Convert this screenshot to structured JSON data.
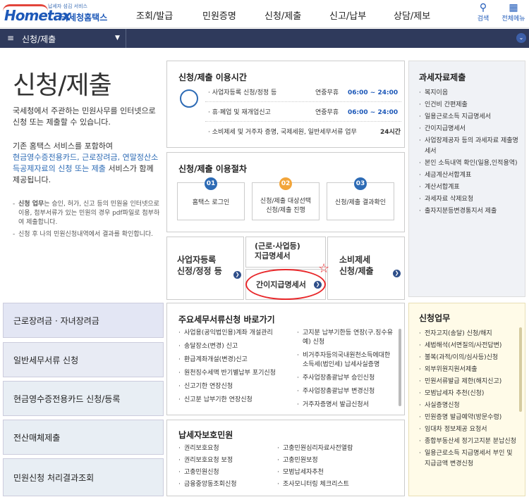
{
  "header": {
    "logo_small": "납세자 섬김 서비스",
    "logo_main": "Hometax",
    "logo_kr": "국세청홈택스",
    "nav": [
      "조회/발급",
      "민원증명",
      "신청/제출",
      "신고/납부",
      "상담/제보"
    ],
    "search_label": "검색",
    "allmenu_label": "전체메뉴"
  },
  "breadcrumb": {
    "title": "신청/제출"
  },
  "page": {
    "title": "신청/제출",
    "intro": "국세청에서 주관하는 민원사무를 인터넷으로 신청 또는 제출할 수 있습니다.",
    "intro2_a": "기존 홈택스 서비스를 포함하여",
    "intro2_hl": "현금영수증전용카드, 근로장려금, 연말정산소득공제자료의 신청 또는 제출",
    "intro2_b": "서비스가 함께 제공됩니다.",
    "note1_bold": "신청 업무",
    "note1": "는 승인, 허가, 신고 등의 민원을 인터넷으로 이용, 첨부서류가 있는 민원의 경우 pdf파일로 첨부하여 제출합니다.",
    "note2": "신청 후 나의 민원신청내역에서 결과를 확인합니다."
  },
  "hours": {
    "title": "신청/제출 이용시간",
    "rows": [
      {
        "a": "· 사업자등록 신청/정정 등",
        "b": "연중무휴",
        "c": "06:00 ~ 24:00"
      },
      {
        "a": "· 휴·폐업 및 재개업신고",
        "b": "연중무휴",
        "c": "06:00 ~ 24:00"
      },
      {
        "a": "· 소비제세 및 거주자 증명, 국제세원, 일반세무서류 업무",
        "b": "",
        "c": "24시간"
      }
    ]
  },
  "procedure": {
    "title": "신청/제출 이용절차",
    "steps": [
      {
        "n": "01",
        "t": "홈택스 로그인"
      },
      {
        "n": "02",
        "t": "신청/제출 대상선택\n신청/제출 진행"
      },
      {
        "n": "03",
        "t": "신청/제출 결과확인"
      }
    ]
  },
  "tiles": {
    "biz": "사업자등록\n신정/정정 등",
    "wage": "(근로·사업등)\n지급명세서",
    "simple": "간이지급명세서",
    "consume": "소비제세\n신청/제출"
  },
  "tax_data": {
    "title": "과세자료제출",
    "items": [
      "복지이음",
      "인건비 간편제출",
      "일용근로소득 지급명세서",
      "간이지급명세서",
      "사업장제공자 등의 과세자료 제출명세서",
      "본인 소득내역 확인(일용,인적용역)",
      "세금계산서합계표",
      "계산서합계표",
      "과세자료 삭제요청",
      "출자지분등변경통지서 제출"
    ]
  },
  "left_buttons": [
    "근로장려금 · 자녀장려금",
    "일반세무서류 신청",
    "현금영수증전용카드 신청/등록",
    "전산매체제출",
    "민원신청 처리결과조회"
  ],
  "quick": {
    "title": "주요세무서류신청 바로가기",
    "col1": [
      "사업용(공익법인용)계좌 개설관리",
      "송달장소(변경) 신고",
      "환급계좌개설(변경)신고",
      "원천징수세액 반기별납부 포기신청",
      "신고기한 연장신청",
      "신고분 납부기한 연장신청"
    ],
    "col2": [
      "고지분 납부기한등 연장(구.징수유예) 신청",
      "비거주자등의국내원천소득에대한 소득세(법인세) 납세사실증명",
      "주사업장총괄납부 승인신청",
      "주사업장총괄납부 변경신청",
      "거주자증명서 발급신청서"
    ]
  },
  "protection": {
    "title": "납세자보호민원",
    "col1": [
      "권리보호요청",
      "권리보호요청 보정",
      "고충민원신청",
      "금융중앙동조회신청"
    ],
    "col2": [
      "고충민원심리자료사전열람",
      "고충민원보정",
      "모범납세자추천",
      "조사모니터링 체크리스트"
    ]
  },
  "duty": {
    "title": "신청업무",
    "items": [
      "전자고지(송달) 신청/해지",
      "세법해석(서면질의/사전답변)",
      "불복(과적/이의/심사등)신청",
      "외부위원지원서제출",
      "민원서류발급 제한(해지신고)",
      "모범납세자 추천(신청)",
      "사실증명신청",
      "민원증명 발급예약(방문수령)",
      "임대차 정보제공 요청서",
      "종합부동산세 정기고지분 분납신청",
      "일용근로소득 지급명세서 부인 및 지급금액 변경신청"
    ]
  }
}
